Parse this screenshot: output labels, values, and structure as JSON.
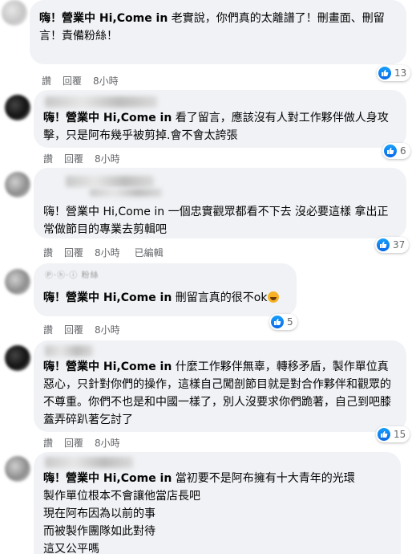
{
  "comments": [
    {
      "tag": "嗨！營業中 Hi,Come in",
      "text": " 老實說，你們真的太離譜了！刪畫面、刪留言！責備粉絲！",
      "actions": [
        "讚",
        "回覆"
      ],
      "time": "8小時",
      "likes": "13"
    },
    {
      "tag": "嗨！營業中 Hi,Come in",
      "text": " 看了留言，應該沒有人對工作夥伴做人身攻擊，只是阿布幾乎被剪掉.會不會太誇張",
      "actions": [
        "讚",
        "回覆"
      ],
      "time": "8小時",
      "likes": "6"
    },
    {
      "tag": "",
      "text": "嗨！營業中 Hi,Come in 一個忠實觀眾都看不下去 沒必要這樣 拿出正常做節目的專業去剪輯吧",
      "actions": [
        "讚",
        "回覆"
      ],
      "time": "8小時",
      "edited": "已編輯",
      "likes": "37"
    },
    {
      "name_partial": "Ⓟ·ⓗ·ⓘ 粉絲",
      "tag": "嗨！營業中 Hi,Come in",
      "text": " 刪留言真的很不ok",
      "actions": [
        "讚",
        "回覆"
      ],
      "time": "8小時",
      "likes": "5"
    },
    {
      "tag": "嗨！營業中 Hi,Come in",
      "text": " 什麼工作夥伴無辜，轉移矛盾，製作單位真惡心，只針對你們的操作，這樣自己闖剖節目就是對合作夥伴和觀眾的不尊重。你們不也是和中國一樣了，別人沒要求你們跪著，自己到吧膝蓋弄碎趴著乞討了",
      "actions": [
        "讚",
        "回覆"
      ],
      "time": "8小時",
      "likes": "15"
    },
    {
      "tag": "嗨！營業中 Hi,Come in",
      "text": " 當初要不是阿布擁有十大青年的光環\n製作單位根本不會讓他當店長吧\n現在阿布因為以前的事\n而被製作團隊如此對待\n這又公平嗎",
      "actions": [],
      "time": "",
      "likes": ""
    }
  ],
  "colors": {
    "bubble": "#f0f2f5",
    "like": "#1877f2",
    "meta": "#65676b"
  },
  "icons": {
    "like": "thumbs-up-icon",
    "haha": "laughing-emoji-icon"
  }
}
